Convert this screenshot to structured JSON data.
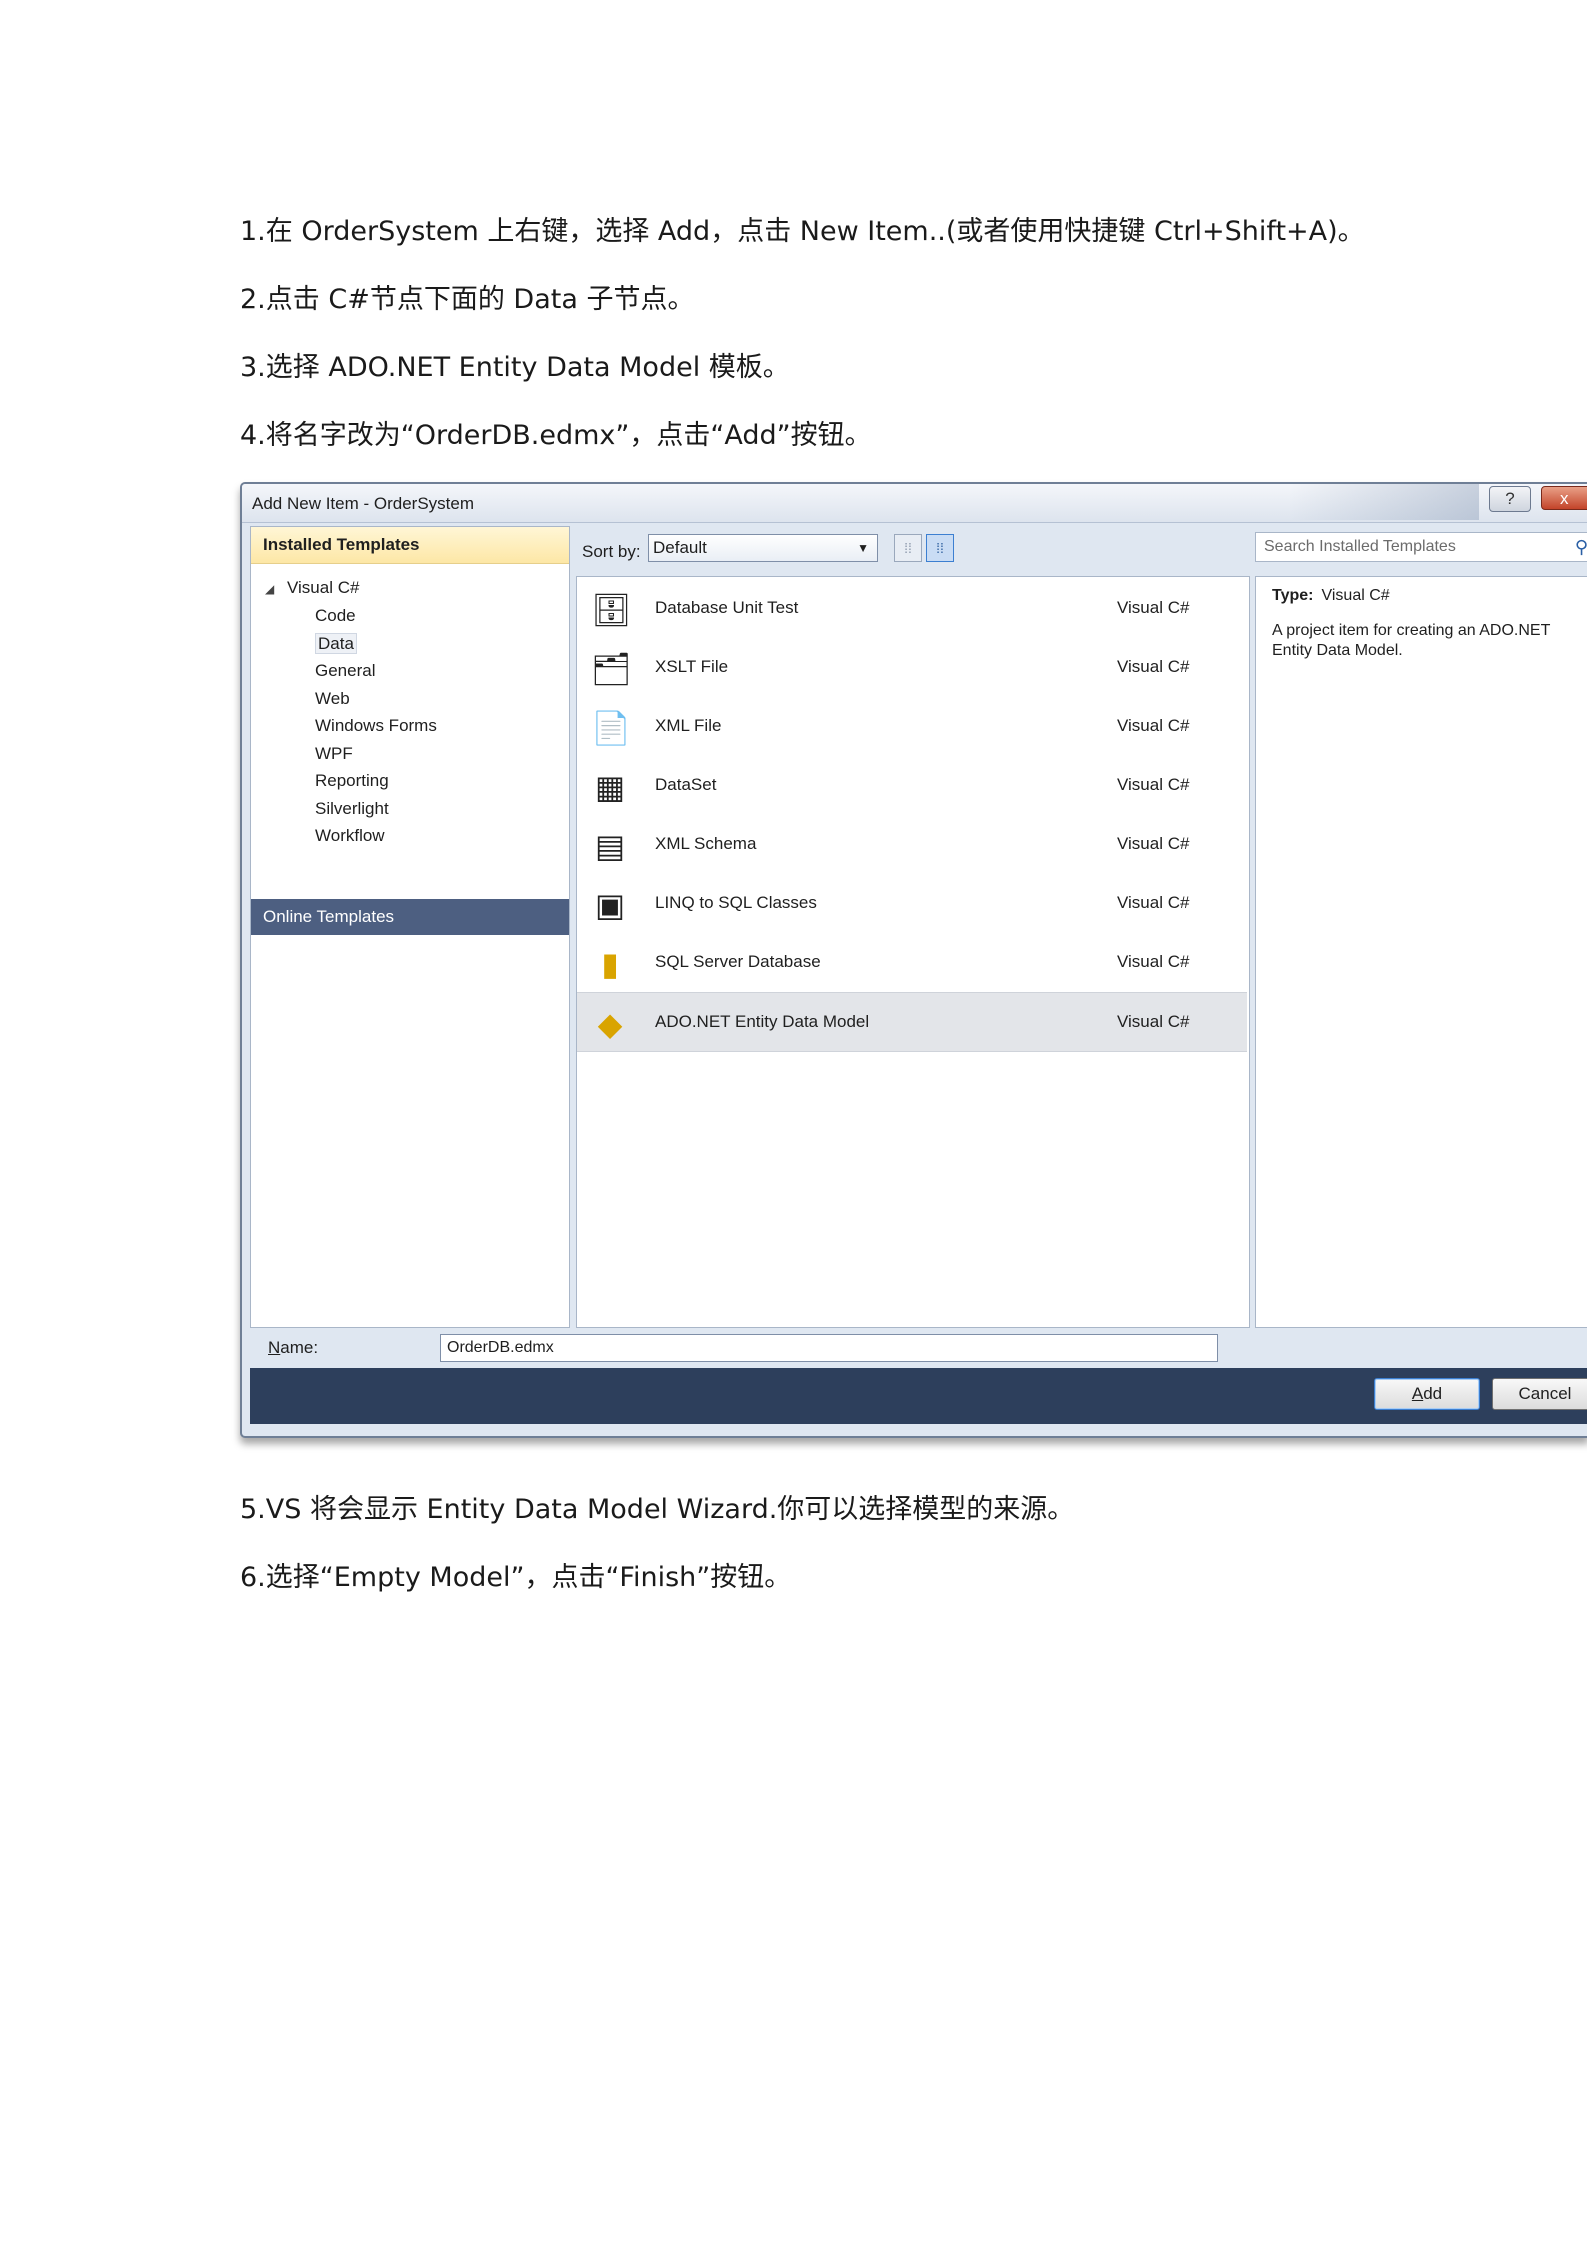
{
  "steps_top": [
    "1.在 OrderSystem 上右键，选择 Add，点击 New Item..(或者使用快捷键 Ctrl+Shift+A)。",
    "2.点击 C#节点下面的 Data 子节点。",
    "3.选择 ADO.NET Entity Data Model  模板。",
    "4.将名字改为“OrderDB.edmx”，点击“Add”按钮。"
  ],
  "steps_bottom": [
    "5.VS 将会显示 Entity Data Model Wizard.你可以选择模型的来源。",
    "6.选择“Empty Model”，点击“Finish”按钮。"
  ],
  "dialog": {
    "title": "Add New Item - OrderSystem",
    "help_label": "?",
    "close_label": "x",
    "installed_header": "Installed Templates",
    "tree_root": "Visual C#",
    "tree_items": [
      "Code",
      "Data",
      "General",
      "Web",
      "Windows Forms",
      "WPF",
      "Reporting",
      "Silverlight",
      "Workflow"
    ],
    "selected_tree_item": "Data",
    "online_header": "Online Templates",
    "sort_by_label": "Sort by:",
    "sort_by_value": "Default",
    "search_placeholder": "Search Installed Templates",
    "templates": [
      {
        "name": "Database Unit Test",
        "lang": "Visual C#",
        "icon": "database-unit-test-icon"
      },
      {
        "name": "XSLT File",
        "lang": "Visual C#",
        "icon": "xslt-file-icon"
      },
      {
        "name": "XML File",
        "lang": "Visual C#",
        "icon": "xml-file-icon"
      },
      {
        "name": "DataSet",
        "lang": "Visual C#",
        "icon": "dataset-icon"
      },
      {
        "name": "XML Schema",
        "lang": "Visual C#",
        "icon": "xml-schema-icon"
      },
      {
        "name": "LINQ to SQL Classes",
        "lang": "Visual C#",
        "icon": "linq-to-sql-icon"
      },
      {
        "name": "SQL Server Database",
        "lang": "Visual C#",
        "icon": "sql-server-database-icon"
      },
      {
        "name": "ADO.NET Entity Data Model",
        "lang": "Visual C#",
        "icon": "entity-data-model-icon"
      }
    ],
    "selected_template": "ADO.NET Entity Data Model",
    "type_label": "Type:",
    "type_value": "Visual C#",
    "description": "A project item for creating an ADO.NET Entity Data Model.",
    "name_label_mnemonic": "N",
    "name_label_rest": "ame:",
    "name_value": "OrderDB.edmx",
    "add_mnemonic": "A",
    "add_rest": "dd",
    "cancel_label": "Cancel"
  }
}
